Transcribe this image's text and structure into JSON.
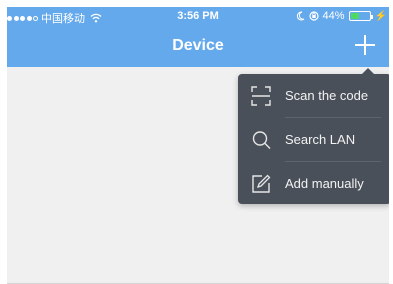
{
  "status_bar": {
    "carrier": "中国移动",
    "time": "3:56 PM",
    "battery_text": "44%",
    "battery_level": 0.44
  },
  "nav": {
    "title": "Device"
  },
  "add_menu": {
    "items": [
      {
        "label": "Scan the code",
        "icon": "scan-icon"
      },
      {
        "label": "Search LAN",
        "icon": "search-icon"
      },
      {
        "label": "Add manually",
        "icon": "edit-icon"
      }
    ]
  },
  "colors": {
    "header": "#64a9ec",
    "popover": "#4a5059",
    "battery": "#4cd964"
  }
}
